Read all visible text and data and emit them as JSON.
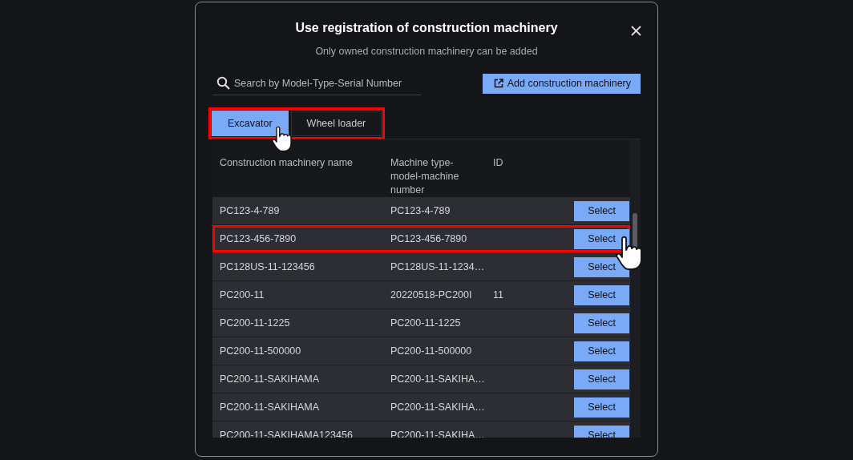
{
  "dialog": {
    "title": "Use registration of construction machinery",
    "subtitle": "Only owned construction machinery can be added"
  },
  "search": {
    "placeholder": "Search by Model-Type-Serial Number"
  },
  "add_button": {
    "label": "Add construction machinery"
  },
  "tabs_highlighted": true,
  "tabs": [
    {
      "label": "Excavator",
      "selected": true,
      "pointer": true
    },
    {
      "label": "Wheel loader",
      "selected": false,
      "pointer": false
    }
  ],
  "table": {
    "columns": [
      "Construction machinery name",
      "Machine type-model-machine number",
      "ID"
    ],
    "rows": [
      {
        "name": "PC123-4-789",
        "type": "PC123-4-789",
        "id": "",
        "action": "Select",
        "highlighted": false,
        "pointer": false
      },
      {
        "name": "PC123-456-7890",
        "type": "PC123-456-7890",
        "id": "",
        "action": "Select",
        "highlighted": true,
        "pointer": true
      },
      {
        "name": "PC128US-11-123456",
        "type": "PC128US-11-1234…",
        "id": "",
        "action": "Select",
        "highlighted": false,
        "pointer": false
      },
      {
        "name": "PC200-11",
        "type": "20220518-PC200I",
        "id": "11",
        "action": "Select",
        "highlighted": false,
        "pointer": false
      },
      {
        "name": "PC200-11-1225",
        "type": "PC200-11-1225",
        "id": "",
        "action": "Select",
        "highlighted": false,
        "pointer": false
      },
      {
        "name": "PC200-11-500000",
        "type": "PC200-11-500000",
        "id": "",
        "action": "Select",
        "highlighted": false,
        "pointer": false
      },
      {
        "name": "PC200-11-SAKIHAMA",
        "type": "PC200-11-SAKIHA…",
        "id": "",
        "action": "Select",
        "highlighted": false,
        "pointer": false
      },
      {
        "name": "PC200-11-SAKIHAMA",
        "type": "PC200-11-SAKIHA…",
        "id": "",
        "action": "Select",
        "highlighted": false,
        "pointer": false
      },
      {
        "name": "PC200-11-SAKIHAMA123456",
        "type": "PC200-11-SAKIHA…",
        "id": "",
        "action": "Select",
        "highlighted": false,
        "pointer": false
      }
    ]
  }
}
